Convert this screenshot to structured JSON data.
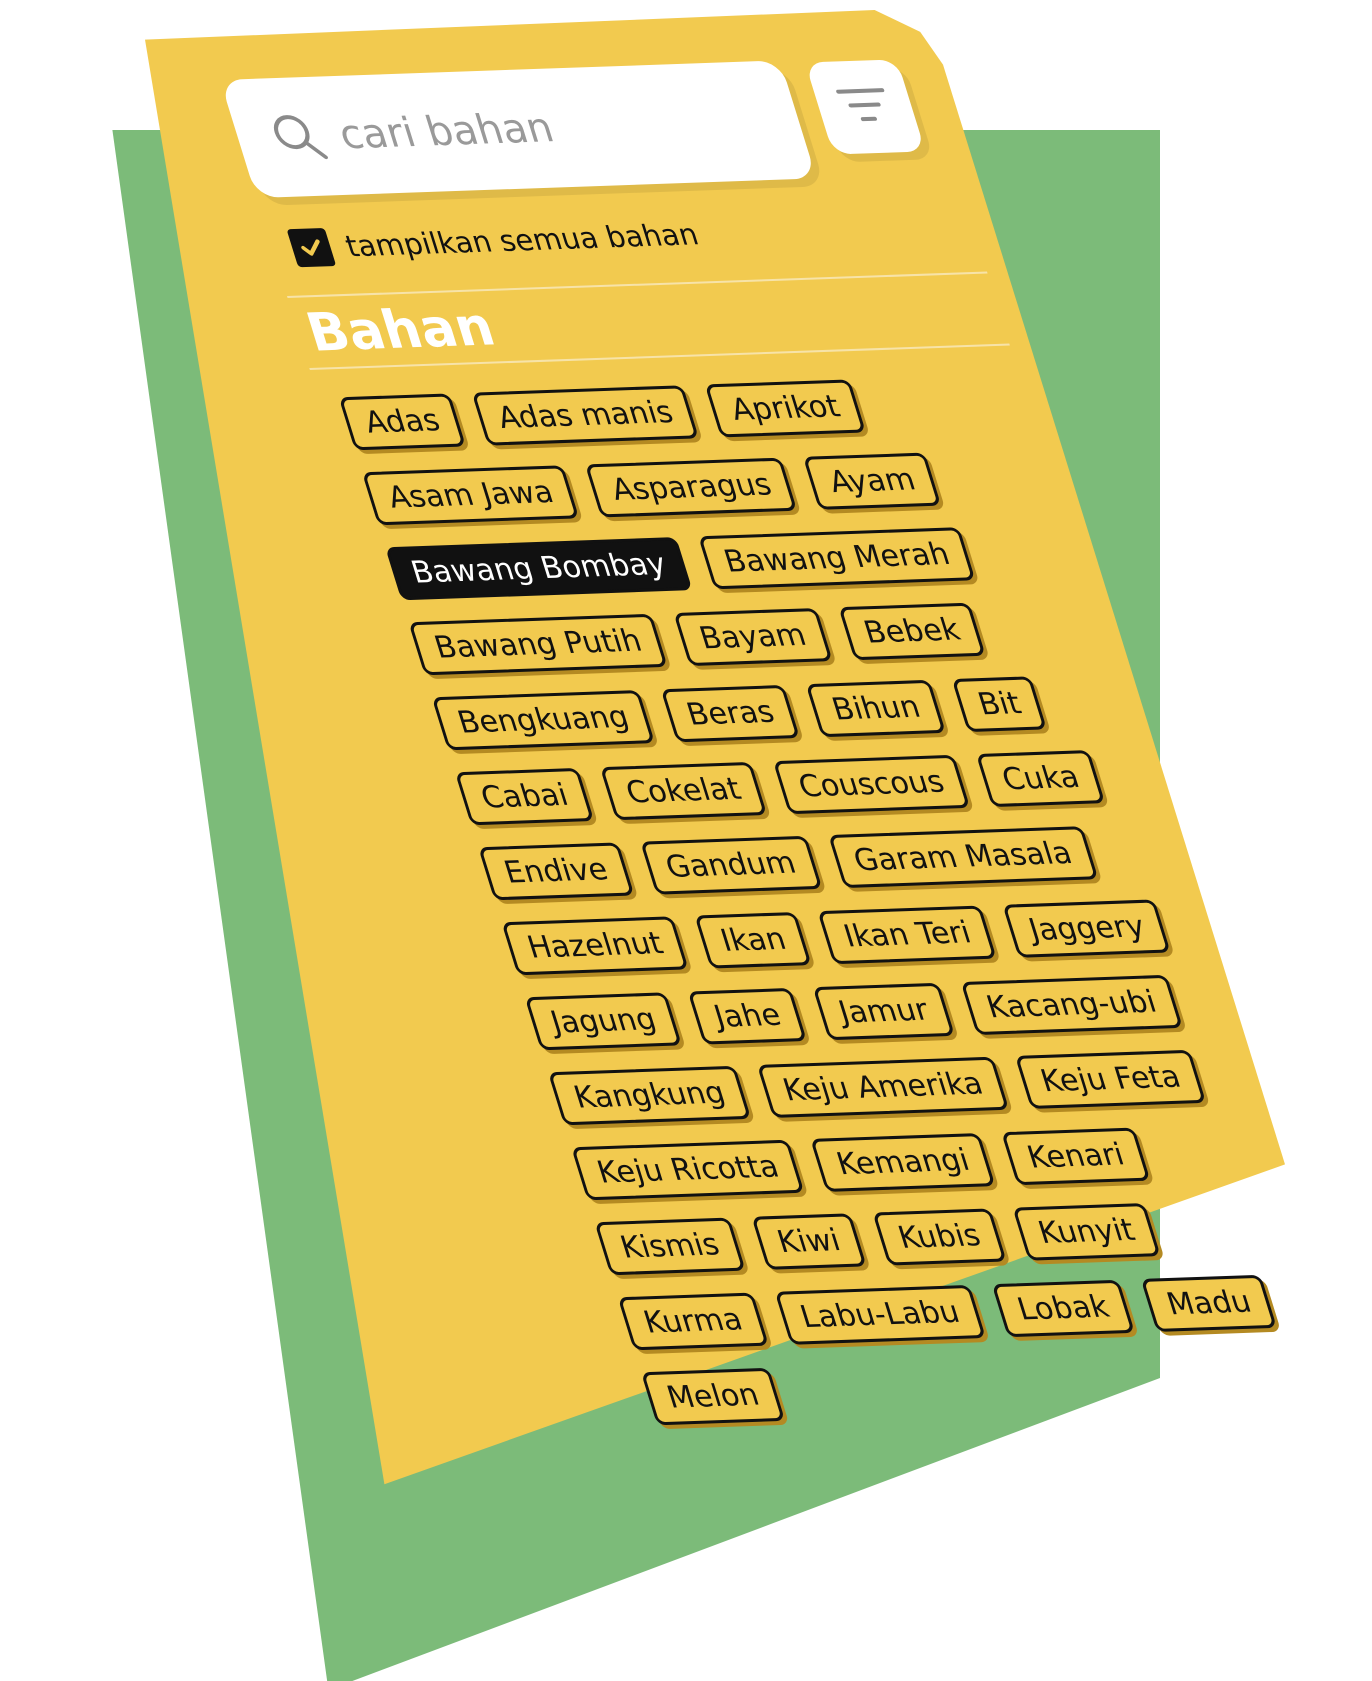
{
  "search": {
    "placeholder": "cari bahan"
  },
  "filter": {
    "icon": "filter-icon"
  },
  "show_all": {
    "label": "tampilkan semua bahan",
    "checked": true
  },
  "section": {
    "title": "Bahan"
  },
  "colors": {
    "card": "#f2ca4f",
    "backing": "#7cbb79",
    "selected_tag": "#111111"
  },
  "ingredients": [
    {
      "label": "Adas",
      "selected": false
    },
    {
      "label": "Adas manis",
      "selected": false
    },
    {
      "label": "Aprikot",
      "selected": false
    },
    {
      "label": "Asam Jawa",
      "selected": false
    },
    {
      "label": "Asparagus",
      "selected": false
    },
    {
      "label": "Ayam",
      "selected": false
    },
    {
      "label": "Bawang Bombay",
      "selected": true
    },
    {
      "label": "Bawang Merah",
      "selected": false
    },
    {
      "label": "Bawang Putih",
      "selected": false
    },
    {
      "label": "Bayam",
      "selected": false
    },
    {
      "label": "Bebek",
      "selected": false
    },
    {
      "label": "Bengkuang",
      "selected": false
    },
    {
      "label": "Beras",
      "selected": false
    },
    {
      "label": "Bihun",
      "selected": false
    },
    {
      "label": "Bit",
      "selected": false
    },
    {
      "label": "Cabai",
      "selected": false
    },
    {
      "label": "Cokelat",
      "selected": false
    },
    {
      "label": "Couscous",
      "selected": false
    },
    {
      "label": "Cuka",
      "selected": false
    },
    {
      "label": "Endive",
      "selected": false
    },
    {
      "label": "Gandum",
      "selected": false
    },
    {
      "label": "Garam Masala",
      "selected": false
    },
    {
      "label": "Hazelnut",
      "selected": false
    },
    {
      "label": "Ikan",
      "selected": false
    },
    {
      "label": "Ikan Teri",
      "selected": false
    },
    {
      "label": "Jaggery",
      "selected": false
    },
    {
      "label": "Jagung",
      "selected": false
    },
    {
      "label": "Jahe",
      "selected": false
    },
    {
      "label": "Jamur",
      "selected": false
    },
    {
      "label": "Kacang-ubi",
      "selected": false
    },
    {
      "label": "Kangkung",
      "selected": false
    },
    {
      "label": "Keju Amerika",
      "selected": false
    },
    {
      "label": "Keju Feta",
      "selected": false
    },
    {
      "label": "Keju Ricotta",
      "selected": false
    },
    {
      "label": "Kemangi",
      "selected": false
    },
    {
      "label": "Kenari",
      "selected": false
    },
    {
      "label": "Kismis",
      "selected": false
    },
    {
      "label": "Kiwi",
      "selected": false
    },
    {
      "label": "Kubis",
      "selected": false
    },
    {
      "label": "Kunyit",
      "selected": false
    },
    {
      "label": "Kurma",
      "selected": false
    },
    {
      "label": "Labu-Labu",
      "selected": false
    },
    {
      "label": "Lobak",
      "selected": false
    },
    {
      "label": "Madu",
      "selected": false
    },
    {
      "label": "Melon",
      "selected": false
    }
  ]
}
